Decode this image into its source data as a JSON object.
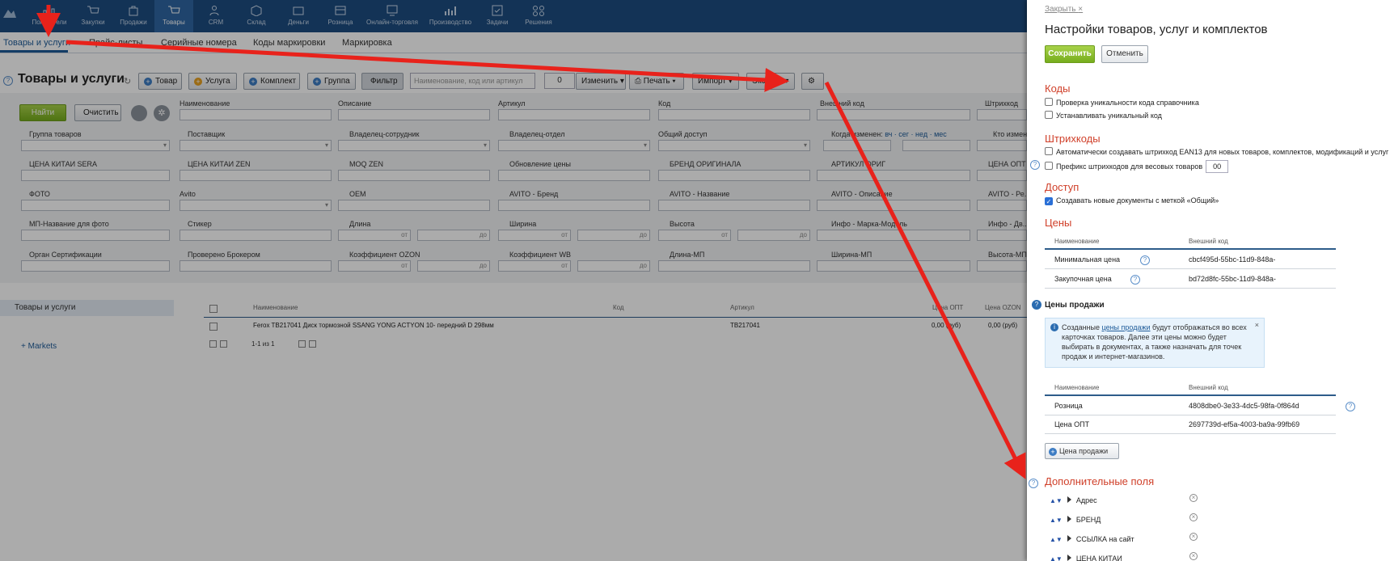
{
  "topnav": {
    "items": [
      {
        "label": "Показатели",
        "icon": "dashboard-icon"
      },
      {
        "label": "Закупки",
        "icon": "cart-icon"
      },
      {
        "label": "Продажи",
        "icon": "bag-icon"
      },
      {
        "label": "Товары",
        "icon": "cart-icon"
      },
      {
        "label": "CRM",
        "icon": "people-icon"
      },
      {
        "label": "Склад",
        "icon": "box-icon"
      },
      {
        "label": "Деньги",
        "icon": "wallet-icon"
      },
      {
        "label": "Розница",
        "icon": "store-icon"
      },
      {
        "label": "Онлайн-торговля",
        "icon": "monitor-icon"
      },
      {
        "label": "Производство",
        "icon": "chart-icon"
      },
      {
        "label": "Задачи",
        "icon": "check-icon"
      },
      {
        "label": "Решения",
        "icon": "apps-icon"
      }
    ]
  },
  "subtabs": [
    "Товары и услуги",
    "Прайс-листы",
    "Серийные номера",
    "Коды маркировки",
    "Маркировка"
  ],
  "page": {
    "title": "Товары и услуги",
    "buttons": {
      "product": "Товар",
      "service": "Услуга",
      "bundle": "Комплект",
      "group": "Группа",
      "filter": "Фильтр",
      "change": "Изменить",
      "print": "Печать",
      "import": "Импорт",
      "export": "Экспорт"
    },
    "search_placeholder": "Наименование, код или артикул",
    "count": "0"
  },
  "filter": {
    "find": "Найти",
    "clear": "Очистить",
    "labels": {
      "name": "Наименование",
      "description": "Описание",
      "article": "Артикул",
      "code": "Код",
      "external_code": "Внешний код",
      "barcode": "Штрихкод",
      "group": "Группа товаров",
      "supplier": "Поставщик",
      "owner_employee": "Владелец-сотрудник",
      "owner_dept": "Владелец-отдел",
      "shared": "Общий доступ",
      "changed": "Когда изменен:",
      "changed_links": "вч · сег · нед · мес",
      "who_changed": "Кто изменил",
      "price_sera": "ЦЕНА КИТАИ SERA",
      "price_zen": "ЦЕНА КИТАИ ZEN",
      "moq": "MOQ ZEN",
      "price_update": "Обновление цены",
      "brand": "БРЕНД ОРИГИНАЛА",
      "article_orig": "АРТИКУЛ ОРИГ",
      "price_opt": "ЦЕНА ОПТ",
      "photo": "ФОТО",
      "avito": "Avito",
      "oem": "OEM",
      "avito_brand": "AVITO - Бренд",
      "avito_name": "AVITO - Название",
      "avito_desc": "AVITO - Описание",
      "avito_price": "AVITO - Ре...",
      "mp_photo": "МП-Название для фото",
      "sticker": "Стикер",
      "length": "Длина",
      "width": "Ширина",
      "height": "Высота",
      "info_model": "Инфо - Марка-Модель",
      "info_dv": "Инфо - Дв...",
      "cert": "Орган Сертификации",
      "broker": "Проверено Брокером",
      "k_ozon": "Коэффициент OZON",
      "k_wb": "Коэффициент WB",
      "len_mp": "Длина-МП",
      "width_mp": "Ширина-МП",
      "height_mp": "Высота-МП"
    },
    "from": "от",
    "to": "до"
  },
  "results": {
    "sidebar": [
      "Товары и услуги",
      "Markets"
    ],
    "headers": [
      "Наименование",
      "Код",
      "Артикул",
      "Цена ОПТ",
      "Цена OZON"
    ],
    "row": {
      "name": "Ferox TB217041 Диск тормозной SSANG YONG ACTYON 10- передний D 298мм",
      "article": "TB217041",
      "price_opt": "0,00 (руб)",
      "price_ozon": "0,00 (руб)"
    },
    "pager": "1-1 из 1"
  },
  "panel": {
    "close": "Закрыть",
    "title": "Настройки товаров, услуг и комплектов",
    "save": "Сохранить",
    "cancel": "Отменить",
    "codes": {
      "title": "Коды",
      "unique_check": "Проверка уникальности кода справочника",
      "set_unique": "Устанавливать уникальный код"
    },
    "barcodes": {
      "title": "Штрихкоды",
      "auto_ean": "Автоматически создавать штрихкод EAN13 для новых товаров, комплектов, модификаций и услуг",
      "prefix": "Префикс штрихкодов для весовых товаров",
      "prefix_value": "00"
    },
    "access": {
      "title": "Доступ",
      "shared": "Создавать новые документы с меткой «Общий»"
    },
    "prices": {
      "title": "Цены",
      "col_name": "Наименование",
      "col_ext": "Внешний код",
      "rows": [
        {
          "name": "Минимальная цена",
          "code": "cbcf495d-55bc-11d9-848a-"
        },
        {
          "name": "Закупочная цена",
          "code": "bd72d8fc-55bc-11d9-848a-"
        }
      ]
    },
    "sale_prices": {
      "title": "Цены продажи",
      "info_pre": "Созданные ",
      "info_link": "цены продажи",
      "info_post": " будут отображаться во всех карточках товаров. Далее эти цены можно будет выбирать в документах, а также назначать для точек продаж и интернет-магазинов.",
      "col_name": "Наименование",
      "col_ext": "Внешний код",
      "rows": [
        {
          "name": "Розница",
          "code": "4808dbe0-3e33-4dc5-98fa-0f864d"
        },
        {
          "name": "Цена ОПТ",
          "code": "2697739d-ef5a-4003-ba9a-99fb69"
        }
      ],
      "add_button": "Цена продажи"
    },
    "extra_fields": {
      "title": "Дополнительные поля",
      "items": [
        "Адрес",
        "БРЕНД",
        "ССЫЛКА на сайт",
        "ЦЕНА КИТАИ"
      ]
    }
  },
  "colors": {
    "nav": "#1d4d80",
    "accent_red": "#d0402a",
    "arrow": "#e8221b",
    "green": "#76ad1d"
  }
}
